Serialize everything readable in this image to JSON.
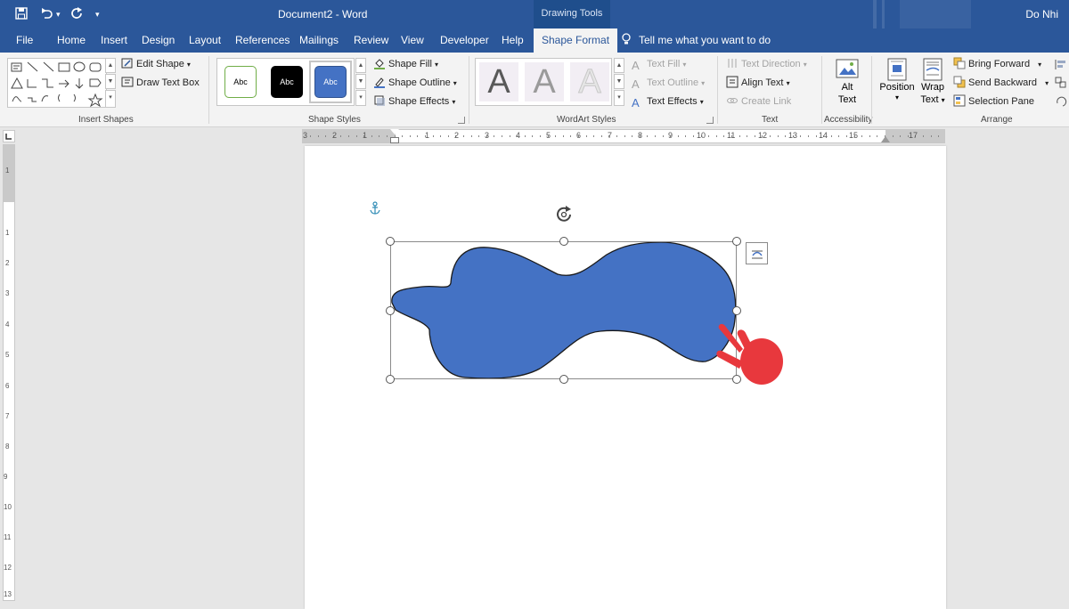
{
  "title_bar": {
    "doc_title": "Document2  -  Word",
    "context_tab_group": "Drawing Tools",
    "user_name": "Do Nhi",
    "quick_access_icons": [
      "save-icon",
      "undo-icon",
      "redo-icon",
      "customize-icon"
    ]
  },
  "tabs": [
    "File",
    "Home",
    "Insert",
    "Design",
    "Layout",
    "References",
    "Mailings",
    "Review",
    "View",
    "Developer",
    "Help",
    "Shape Format"
  ],
  "active_tab": "Shape Format",
  "tell_me": "Tell me what you want to do",
  "ribbon": {
    "insert_shapes": {
      "edit_shape": "Edit Shape",
      "draw_text_box": "Draw Text Box",
      "label": "Insert Shapes"
    },
    "shape_styles": {
      "presets": [
        "Abc",
        "Abc",
        "Abc"
      ],
      "shape_fill": "Shape Fill",
      "shape_outline": "Shape Outline",
      "shape_effects": "Shape Effects",
      "label": "Shape Styles"
    },
    "wordart_styles": {
      "glyph": "A",
      "text_fill": "Text Fill",
      "text_outline": "Text Outline",
      "text_effects": "Text Effects",
      "label": "WordArt Styles"
    },
    "text": {
      "text_direction": "Text Direction",
      "align_text": "Align Text",
      "create_link": "Create Link",
      "label": "Text"
    },
    "accessibility": {
      "alt_text_line1": "Alt",
      "alt_text_line2": "Text",
      "label": "Accessibility"
    },
    "arrange": {
      "position": "Position",
      "wrap_text_line1": "Wrap",
      "wrap_text_line2": "Text",
      "bring_forward": "Bring Forward",
      "send_backward": "Send Backward",
      "selection_pane": "Selection Pane",
      "label": "Arrange"
    }
  },
  "ruler": {
    "h_labels": [
      "3",
      "2",
      "1",
      "1",
      "2",
      "3",
      "4",
      "5",
      "6",
      "7",
      "8",
      "9",
      "10",
      "11",
      "12",
      "13",
      "14",
      "15",
      "17"
    ],
    "v_labels": [
      "1",
      "1",
      "2",
      "3",
      "4",
      "5",
      "6",
      "7",
      "8",
      "9",
      "10",
      "11",
      "12",
      "13"
    ]
  },
  "colors": {
    "accent": "#2b579a",
    "shape_fill": "#4472c4",
    "hand_cursor": "#e8383d"
  }
}
